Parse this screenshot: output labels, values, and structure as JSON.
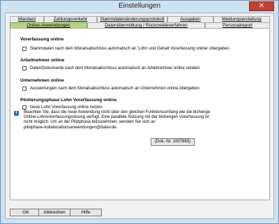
{
  "window": {
    "title": "Einstellungen",
    "close_label": "✕"
  },
  "tabs_row1": [
    {
      "label": "Mandant"
    },
    {
      "label": "Zahlungsverkehr"
    },
    {
      "label": "Stammdatenänderungsprotokoll"
    },
    {
      "label": "Ausgaben"
    },
    {
      "label": "Meldungserstellung"
    }
  ],
  "tabs_row2": [
    {
      "label": "Online-Anwendungen"
    },
    {
      "label": "Datenübermittlung / Rückmeldeverfahren"
    },
    {
      "label": "Personalreport"
    }
  ],
  "sections": {
    "vorerfassung": {
      "title": "Vorerfassung online",
      "checkbox_label": "Stammdaten nach dem Monatsabschluss automatisch an 'Lohn und Gehalt Vorerfassung online' übergeben"
    },
    "arbeitnehmer": {
      "title": "Arbeitnehmer online",
      "checkbox_label": "Daten/Dokumente nach dem Monatsabschluss automatisch an Arbeitnehmer online senden"
    },
    "unternehmen": {
      "title": "Unternehmen online",
      "checkbox_label": "Auswertungen nach dem Monatsabschluss automatisch an Unternehmen online übergeben"
    },
    "pilot": {
      "title": "Pilotierungsphase Lohn Vorerfassung online",
      "checkbox_label": "Neue Lohn Vorerfassung online nutzen",
      "info_lines": [
        "Beachten Sie, dass die neue Anwendung nicht über den gleichen Funktionsumfang wie die bisherige",
        "Online-Lohnvorerfassungslösung verfügt. Eine parallele Nutzung mit der bisherigen Vorerfassung ist",
        "nicht möglich. Um an der Pilotphase teilzunehmen, wenden Sie sich an",
        "pilotphase-kollaborationsanwendungen@datev.de."
      ],
      "doc_button": "(Dok.-Nr. 1007883)"
    }
  },
  "footer": {
    "ok": "OK",
    "cancel": "Abbrechen",
    "help": "Hilfe"
  },
  "colors": {
    "active_tab": "#b3d67a",
    "close_button": "#c7402f",
    "info_icon": "#2d6fb7"
  }
}
